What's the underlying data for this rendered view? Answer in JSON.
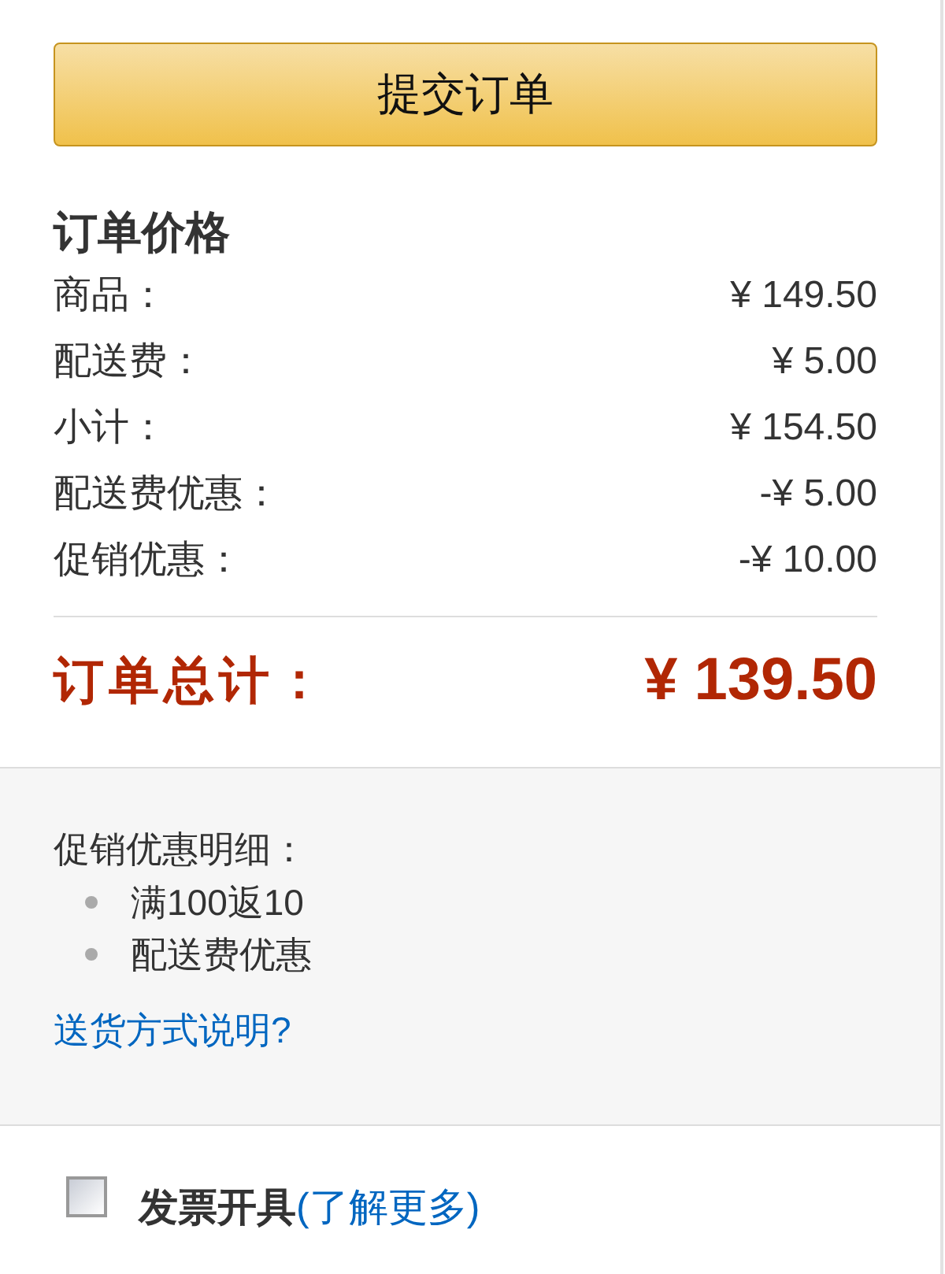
{
  "submit_button": {
    "label": "提交订单"
  },
  "order_summary": {
    "title": "订单价格",
    "rows": [
      {
        "label": "商品：",
        "value": "¥ 149.50"
      },
      {
        "label": "配送费：",
        "value": "¥ 5.00"
      },
      {
        "label": "小计：",
        "value": "¥ 154.50"
      },
      {
        "label": "配送费优惠：",
        "value": "-¥ 5.00"
      },
      {
        "label": "促销优惠：",
        "value": "-¥ 10.00"
      }
    ],
    "total": {
      "label": "订单总计：",
      "value": "¥ 139.50"
    }
  },
  "promotions": {
    "title": "促销优惠明细：",
    "items": [
      "满100返10",
      "配送费优惠"
    ],
    "link": "送货方式说明?"
  },
  "invoice": {
    "checked": false,
    "label": "发票开具",
    "link": "(了解更多)"
  }
}
